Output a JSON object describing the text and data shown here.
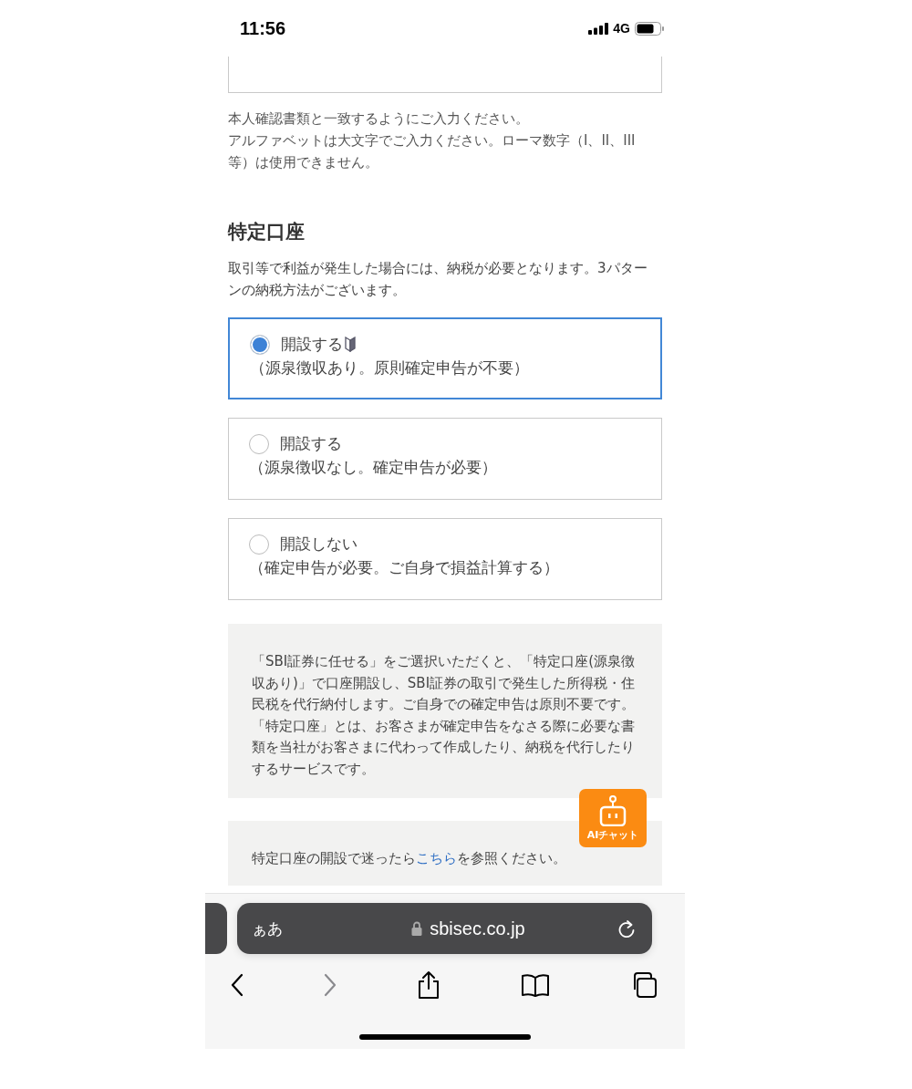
{
  "status_bar": {
    "time": "11:56",
    "network": "4G"
  },
  "name_notes": [
    "本人確認書類と一致するようにご入力ください。",
    "アルファベットは大文字でご入力ください。ローマ数字（I、II、III等）は使用できません。"
  ],
  "section": {
    "title": "特定口座",
    "description": "取引等で利益が発生した場合には、納税が必要となります。3パターンの納税方法がございます。",
    "options": [
      {
        "label": "開設する",
        "detail": "（源泉徴収あり。原則確定申告が不要）",
        "selected": true,
        "beginner_mark": true
      },
      {
        "label": "開設する",
        "detail": "（源泉徴収なし。確定申告が必要）",
        "selected": false,
        "beginner_mark": false
      },
      {
        "label": "開設しない",
        "detail": "（確定申告が必要。ご自身で損益計算する）",
        "selected": false,
        "beginner_mark": false
      }
    ]
  },
  "info_box": {
    "paragraphs": [
      "「SBI証券に任せる」をご選択いただくと、「特定口座(源泉徴収あり)」で口座開設し、SBI証券の取引で発生した所得税・住民税を代行納付します。ご自身での確定申告は原則不要です。",
      "「特定口座」とは、お客さまが確定申告をなさる際に必要な書類を当社がお客さまに代わって作成したり、納税を代行したりするサービスです。"
    ]
  },
  "help_box": {
    "before": "特定口座の開設で迷ったら",
    "link": "こちら",
    "after": "を参照ください。"
  },
  "ai_chat_button": {
    "label": "AIチャット"
  },
  "browser": {
    "text_size_button": "ぁあ",
    "url": "sbisec.co.jp"
  }
}
